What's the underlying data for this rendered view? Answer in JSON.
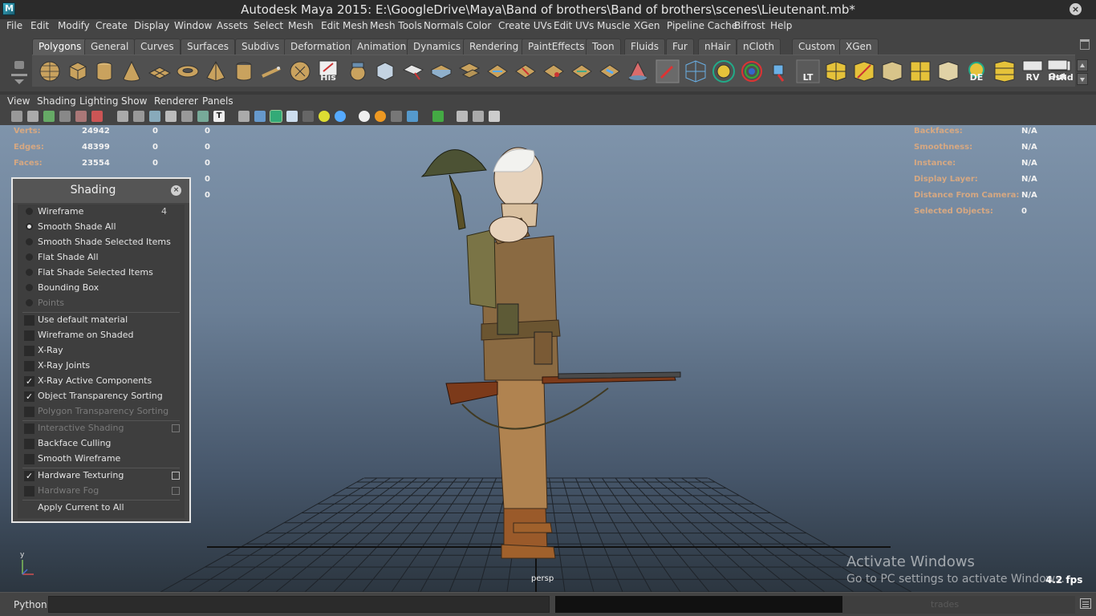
{
  "window": {
    "title": "Autodesk Maya 2015: E:\\GoogleDrive\\Maya\\Band of brothers\\Band of brothers\\scenes\\Lieutenant.mb*",
    "close_glyph": "×"
  },
  "menubar": [
    "File",
    "Edit",
    "Modify",
    "Create",
    "Display",
    "Window",
    "Assets",
    "Select",
    "Mesh",
    "Edit Mesh",
    "Mesh Tools",
    "Normals",
    "Color",
    "Create UVs",
    "Edit UVs",
    "Muscle",
    "XGen",
    "Pipeline Cache",
    "Bifrost",
    "Help"
  ],
  "shelf": {
    "tabs": [
      "Polygons",
      "General",
      "Curves",
      "Surfaces",
      "Subdivs",
      "Deformation",
      "Animation",
      "Dynamics",
      "Rendering",
      "PaintEffects",
      "Toon",
      "Fluids",
      "Fur",
      "nHair",
      "nCloth",
      "Custom",
      "XGen"
    ],
    "active_tab": "Polygons",
    "icons": [
      "sphere-icon",
      "cube-icon",
      "cylinder-icon",
      "cone-icon",
      "plane-icon",
      "torus-icon",
      "pyramid-icon",
      "pipe-icon",
      "helix-icon",
      "soccer-ball-icon",
      "history-icon",
      "combine-icon",
      "separate-icon",
      "extract-icon",
      "smooth-icon",
      "boolean-icon",
      "average-vertices-icon",
      "merge-icon",
      "bridge-icon",
      "append-polygon-icon",
      "fill-hole-icon",
      "split-polygon-icon",
      "sculpt-icon",
      "paint-weights-icon",
      "grid-icon",
      "snap-magnet-icon",
      "rotate-icon",
      "transfer-icon",
      "lt-icon",
      "uv-layout-icon",
      "uv-unfold-icon",
      "uv-project-icon",
      "uv-planar-icon",
      "uv-cylindrical-icon",
      "uv-spherical-icon",
      "de-icon",
      "uv-editor-icon",
      "rv-icon",
      "hshd-icon",
      "out-icon"
    ],
    "icon_labels": {
      "history": "His",
      "lt": "LT",
      "de": "DE",
      "rv": "RV",
      "hshd": "Hshd",
      "out": "Out"
    }
  },
  "panel_menu": [
    "View",
    "Shading",
    "Lighting",
    "Show",
    "Renderer",
    "Panels"
  ],
  "hud_left": [
    {
      "label": "Verts:",
      "values": [
        "24942",
        "0",
        "0"
      ]
    },
    {
      "label": "Edges:",
      "values": [
        "48399",
        "0",
        "0"
      ]
    },
    {
      "label": "Faces:",
      "values": [
        "23554",
        "0",
        "0"
      ]
    },
    {
      "label": "",
      "values": [
        "",
        "",
        "0"
      ]
    },
    {
      "label": "",
      "values": [
        "",
        "",
        "0"
      ]
    }
  ],
  "hud_right": [
    {
      "label": "Backfaces:",
      "value": "N/A"
    },
    {
      "label": "Smoothness:",
      "value": "N/A"
    },
    {
      "label": "Instance:",
      "value": "N/A"
    },
    {
      "label": "Display Layer:",
      "value": "N/A"
    },
    {
      "label": "Distance From Camera:",
      "value": "N/A"
    },
    {
      "label": "Selected Objects:",
      "value": "0"
    }
  ],
  "viewport": {
    "camera_label": "persp",
    "fps": "4.2 fps",
    "watermark_line1": "Activate Windows",
    "watermark_line2": "Go to PC settings to activate Windows."
  },
  "shading_panel": {
    "title": "Shading",
    "close_glyph": "×",
    "radio_items": [
      {
        "label": "Wireframe",
        "hotkey": "4",
        "selected": false,
        "disabled": false
      },
      {
        "label": "Smooth Shade All",
        "hotkey": "",
        "selected": true,
        "disabled": false
      },
      {
        "label": "Smooth Shade Selected Items",
        "hotkey": "",
        "selected": false,
        "disabled": false
      },
      {
        "label": "Flat Shade All",
        "hotkey": "",
        "selected": false,
        "disabled": false
      },
      {
        "label": "Flat Shade Selected Items",
        "hotkey": "",
        "selected": false,
        "disabled": false
      },
      {
        "label": "Bounding Box",
        "hotkey": "",
        "selected": false,
        "disabled": false
      },
      {
        "label": "Points",
        "hotkey": "",
        "selected": false,
        "disabled": true
      }
    ],
    "check_items_1": [
      {
        "label": "Use default material",
        "checked": false,
        "disabled": false
      },
      {
        "label": "Wireframe on Shaded",
        "checked": false,
        "disabled": false
      },
      {
        "label": "X-Ray",
        "checked": false,
        "disabled": false
      },
      {
        "label": "X-Ray Joints",
        "checked": false,
        "disabled": false
      },
      {
        "label": "X-Ray Active Components",
        "checked": true,
        "disabled": false
      },
      {
        "label": "Object Transparency Sorting",
        "checked": true,
        "disabled": false
      },
      {
        "label": "Polygon Transparency Sorting",
        "checked": false,
        "disabled": true
      }
    ],
    "check_items_2": [
      {
        "label": "Interactive Shading",
        "checked": false,
        "disabled": true,
        "has_option": true
      },
      {
        "label": "Backface Culling",
        "checked": false,
        "disabled": false,
        "has_option": false
      },
      {
        "label": "Smooth Wireframe",
        "checked": false,
        "disabled": false,
        "has_option": false
      }
    ],
    "check_items_3": [
      {
        "label": "Hardware Texturing",
        "checked": true,
        "disabled": false,
        "has_option": true
      },
      {
        "label": "Hardware Fog",
        "checked": false,
        "disabled": true,
        "has_option": true
      }
    ],
    "apply_label": "Apply Current to All",
    "check_glyph": "✓"
  },
  "statusbar": {
    "python_label": "Python",
    "ghost_label": "trades"
  },
  "colors": {
    "hud_label": "#d6a882",
    "panel_bg": "#444444",
    "viewport_top": "#7f94ab",
    "viewport_bottom": "#2c3640"
  }
}
